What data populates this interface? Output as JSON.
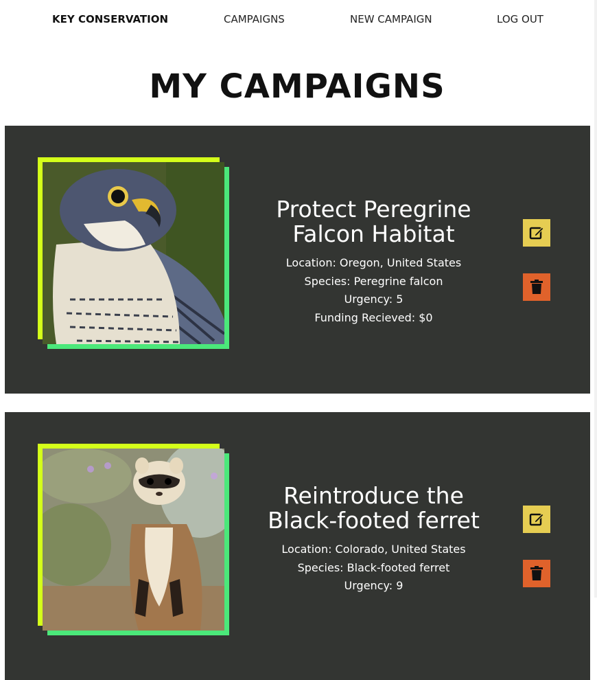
{
  "nav": {
    "brand": "KEY CONSERVATION",
    "campaigns": "CAMPAIGNS",
    "new_campaign": "NEW CAMPAIGN",
    "log_out": "LOG OUT"
  },
  "page_title": "MY CAMPAIGNS",
  "colors": {
    "card_bg": "#333532",
    "frame_yellow": "#d4ff1a",
    "frame_green": "#4be87a",
    "edit_button": "#e6cd52",
    "delete_button": "#e0622b"
  },
  "icons": {
    "edit": "edit-icon",
    "delete": "trash-icon"
  },
  "campaigns": [
    {
      "title_line1": "Protect Peregrine",
      "title_line2": "Falcon Habitat",
      "location": "Location: Oregon, United States",
      "species": "Species: Peregrine falcon",
      "urgency": "Urgency: 5",
      "funding": "Funding Recieved: $0"
    },
    {
      "title_line1": "Reintroduce the",
      "title_line2": "Black-footed ferret",
      "location": "Location: Colorado, United States",
      "species": "Species: Black-footed ferret",
      "urgency": "Urgency: 9"
    }
  ]
}
